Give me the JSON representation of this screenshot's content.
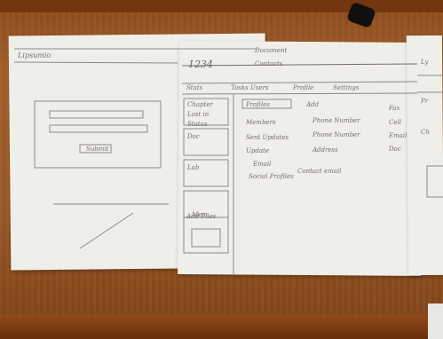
{
  "scene": {
    "description_visible_text": {
      "left_header": "Lipsumio",
      "center_title": "1234",
      "center_sub_1": "Document",
      "center_sub_2": "Contacts",
      "center_menu": [
        "Stats",
        "Tasks Users",
        "Profile",
        "Settings"
      ],
      "center_col1": [
        "Chapter",
        "Lost in",
        "Status",
        "Doc",
        "Lab",
        "Mem"
      ],
      "center_col2": [
        "Profiles",
        "Members",
        "Sent Updates",
        "Update",
        "Email",
        "Social Profiles"
      ],
      "center_col3": [
        "Add",
        "Phone Number",
        "Phone Number",
        "Address",
        "Contact email"
      ],
      "center_col4": [
        "Fax",
        "Cell",
        "Email",
        "Doc"
      ],
      "center_footer": "Add Files",
      "left_dialog_button": "Submit",
      "right_edge": [
        "Ly",
        "Pr",
        "Ch"
      ]
    }
  }
}
